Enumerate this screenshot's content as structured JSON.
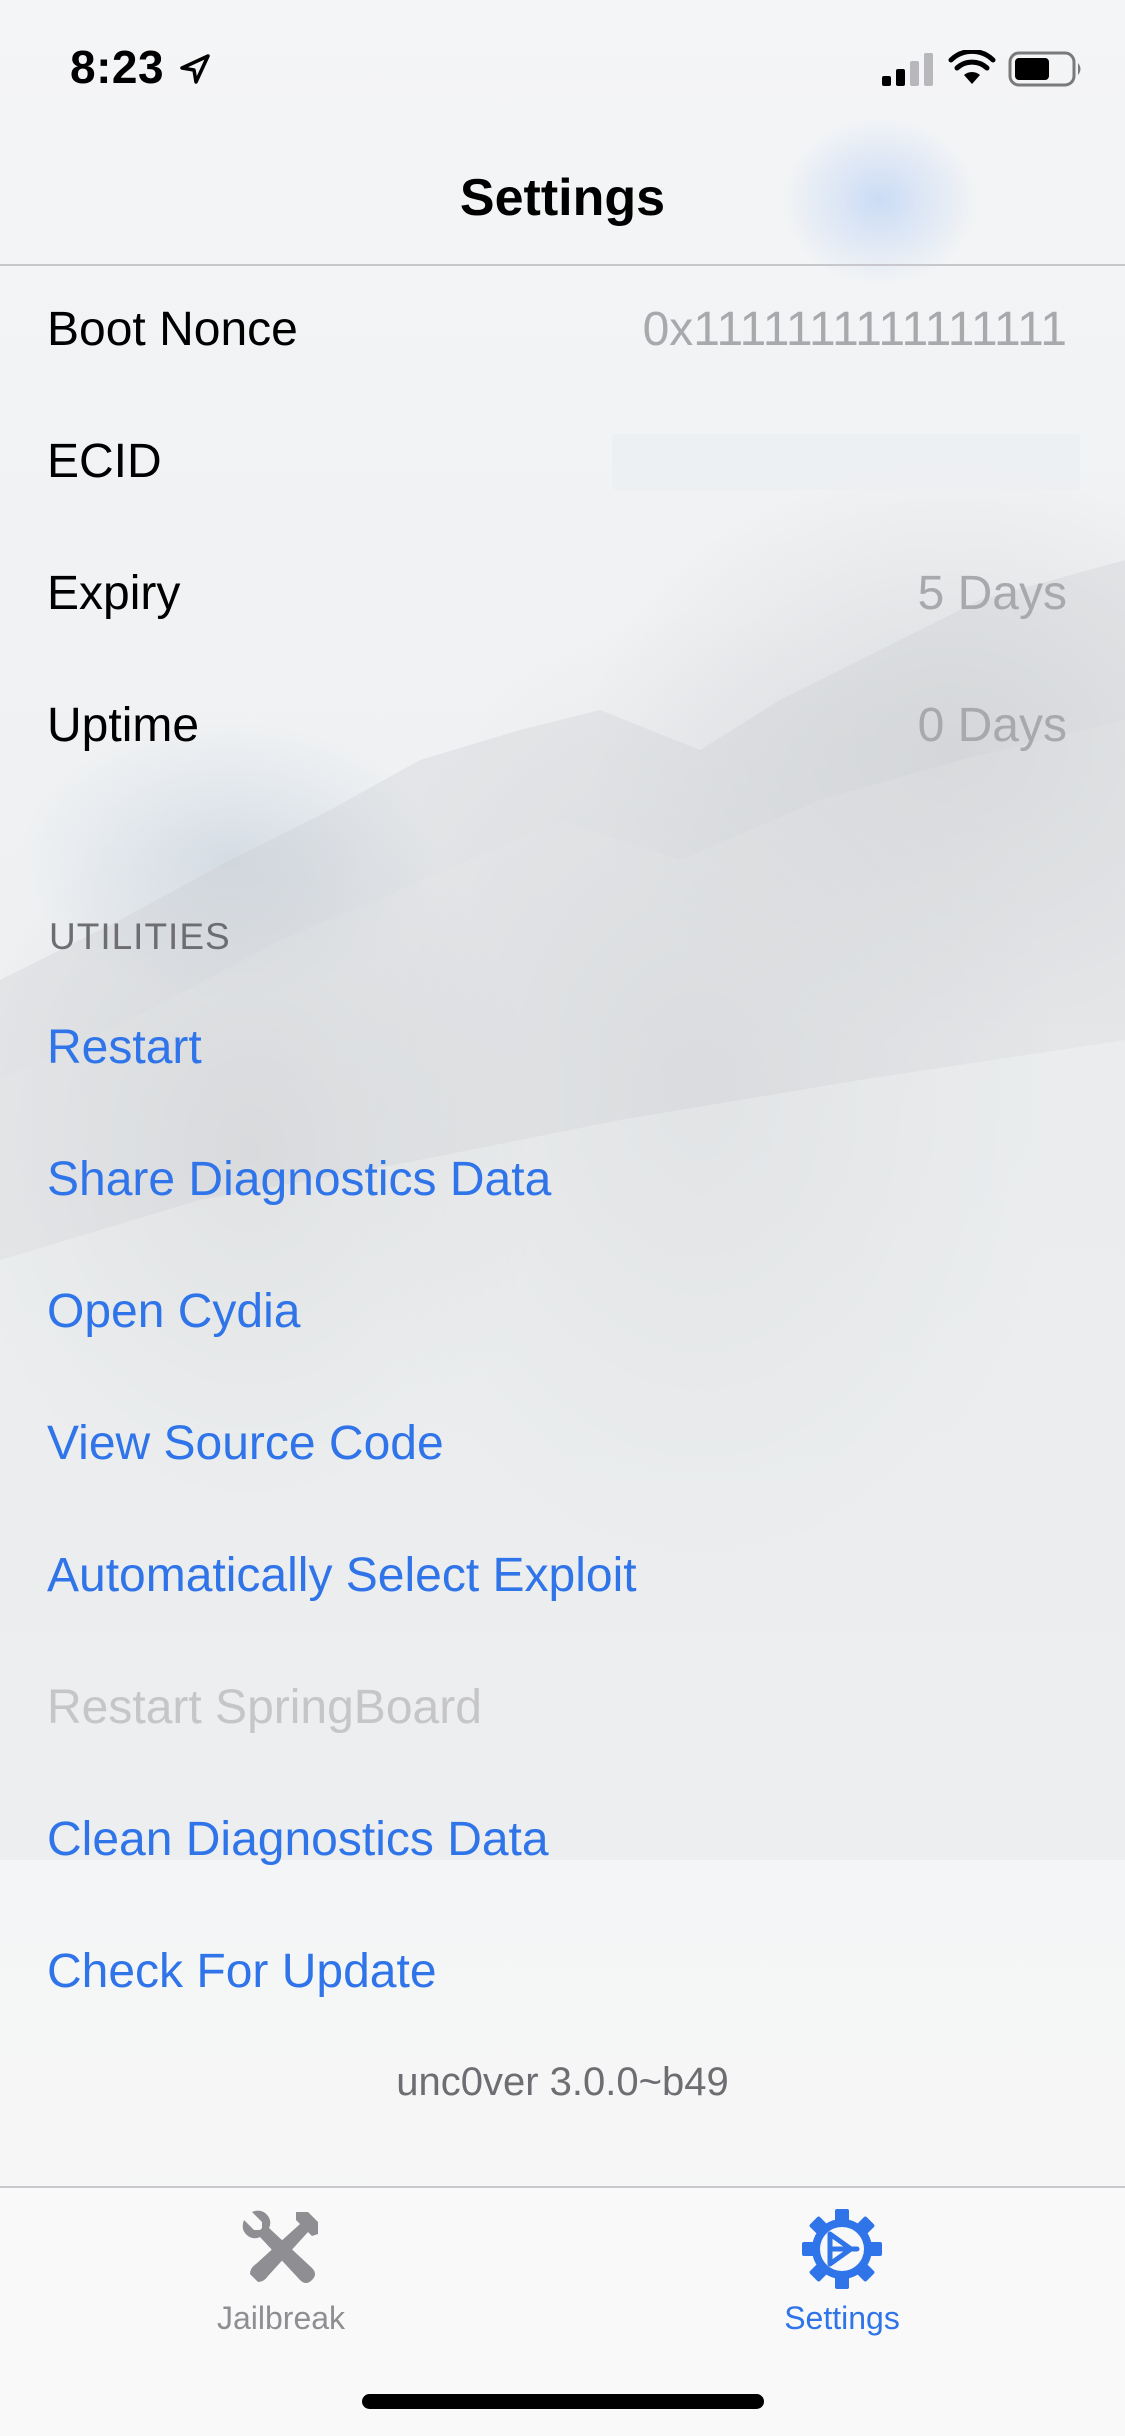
{
  "status_bar": {
    "time": "8:23"
  },
  "nav": {
    "title": "Settings"
  },
  "info_rows": [
    {
      "label": "Boot Nonce",
      "value": "0x1111111111111111"
    },
    {
      "label": "ECID",
      "value": ""
    },
    {
      "label": "Expiry",
      "value": "5 Days"
    },
    {
      "label": "Uptime",
      "value": "0 Days"
    }
  ],
  "utilities": {
    "header": "UTILITIES",
    "actions": [
      {
        "label": "Restart",
        "enabled": true
      },
      {
        "label": "Share Diagnostics Data",
        "enabled": true
      },
      {
        "label": "Open Cydia",
        "enabled": true
      },
      {
        "label": "View Source Code",
        "enabled": true
      },
      {
        "label": "Automatically Select Exploit",
        "enabled": true
      },
      {
        "label": "Restart SpringBoard",
        "enabled": false
      },
      {
        "label": "Clean Diagnostics Data",
        "enabled": true
      },
      {
        "label": "Check For Update",
        "enabled": true
      }
    ]
  },
  "footer": {
    "version": "unc0ver 3.0.0~b49"
  },
  "tab_bar": {
    "tabs": [
      {
        "label": "Jailbreak",
        "icon": "tools-icon",
        "selected": false
      },
      {
        "label": "Settings",
        "icon": "gear-icon",
        "selected": true
      }
    ]
  },
  "colors": {
    "accent": "#2f74e8",
    "disabled": "#c6c6c8",
    "secondary_text": "#a9a9ad",
    "tab_inactive": "#8e8e93"
  }
}
